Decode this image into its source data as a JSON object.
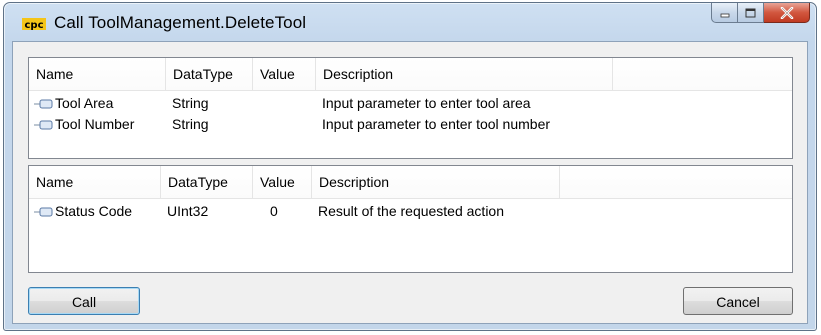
{
  "window": {
    "title": "Call ToolManagement.DeleteTool",
    "icon": "cpc-logo-icon",
    "caption_buttons": [
      "minimize-icon",
      "maximize-icon",
      "close-icon"
    ]
  },
  "inputs": {
    "columns": [
      "Name",
      "DataType",
      "Value",
      "Description"
    ],
    "rows": [
      {
        "name": "Tool Area",
        "datatype": "String",
        "value": "",
        "description": "Input parameter to enter tool area"
      },
      {
        "name": "Tool Number",
        "datatype": "String",
        "value": "",
        "description": "Input parameter to enter tool number"
      }
    ]
  },
  "outputs": {
    "columns": [
      "Name",
      "DataType",
      "Value",
      "Description"
    ],
    "rows": [
      {
        "name": "Status Code",
        "datatype": "UInt32",
        "value": "0",
        "description": "Result of the requested action"
      }
    ]
  },
  "buttons": {
    "call": "Call",
    "cancel": "Cancel"
  }
}
